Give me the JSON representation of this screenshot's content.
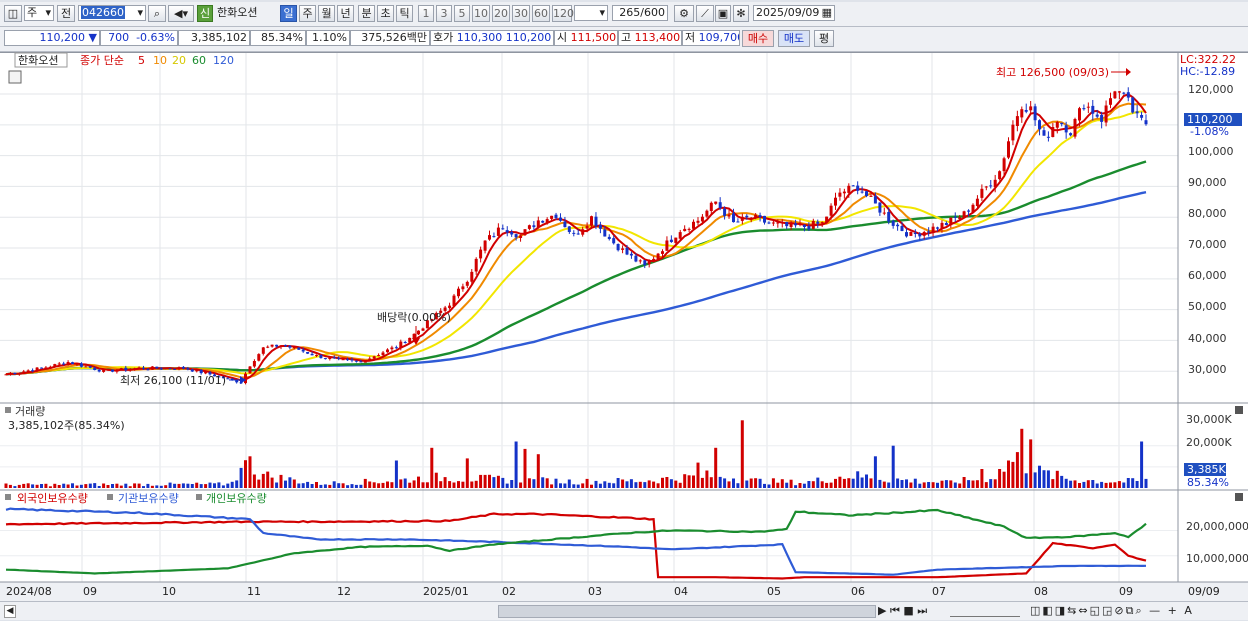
{
  "toolbar1": {
    "type_select": "주",
    "prev_label": "전",
    "code_value": "042660",
    "new_badge": "신",
    "stock_name": "한화오션",
    "periods": [
      "일",
      "주",
      "월",
      "년",
      "분",
      "초",
      "틱"
    ],
    "numbers": [
      "1",
      "3",
      "5",
      "10",
      "20",
      "30",
      "60",
      "120"
    ],
    "count_value": "265",
    "count_total": "/600",
    "date_value": "2025/09/09"
  },
  "toolbar2": {
    "price": "110,200",
    "change_arrow": "▼",
    "change": "700",
    "change_pct": "-0.63%",
    "volume": "3,385,102",
    "vol_ratio": "85.34%",
    "turnover": "1.10%",
    "trade_value": "375,526백만",
    "hoga_label": "호가",
    "hoga_ask": "110,300",
    "hoga_bid": "110,200",
    "open_label": "시",
    "open": "111,500",
    "high_label": "고",
    "high": "113,400",
    "low_label": "저",
    "low": "109,700",
    "buy_label": "매수",
    "sell_label": "매도",
    "eval_label": "평"
  },
  "price_panel": {
    "stock_label": "한화오션",
    "ma_title": "종가 단순",
    "ma_periods": [
      "5",
      "10",
      "20",
      "60",
      "120"
    ],
    "ma_colors": [
      "#d10000",
      "#f08a00",
      "#f2e600",
      "#1a8c2e",
      "#2f5bd6"
    ],
    "lc_label": "LC:322.22",
    "hc_label": "HC:-12.89",
    "y_labels": [
      "120,000",
      "110,000",
      "100,000",
      "90,000",
      "80,000",
      "70,000",
      "60,000",
      "50,000",
      "40,000",
      "30,000"
    ],
    "current_price": "110,200",
    "current_pct": "-1.08%",
    "annotation_high": "최고 126,500 (09/03)",
    "annotation_low": "최저 26,100 (11/01)",
    "annotation_div": "배당락(0.00%)"
  },
  "volume_panel": {
    "title": "거래량",
    "info": "3,385,102주(85.34%)",
    "y_labels": [
      "30,000K",
      "20,000K",
      "10,000K"
    ],
    "current": "3,385K",
    "current_pct": "85.34%"
  },
  "holding_panel": {
    "series_names": [
      "외국인보유수량",
      "기관보유수량",
      "개인보유수량"
    ],
    "series_colors": [
      "#d10000",
      "#2f5bd6",
      "#1a8c2e"
    ],
    "y_labels": [
      "20,000,000",
      "10,000,000"
    ]
  },
  "x_axis": {
    "labels": [
      "2024/08",
      "09",
      "10",
      "11",
      "12",
      "2025/01",
      "02",
      "03",
      "04",
      "05",
      "06",
      "07",
      "08",
      "09"
    ],
    "right_label": "09/09"
  },
  "chart_data": {
    "type": "candlestick",
    "price_range": [
      20000,
      133000
    ],
    "keyframes": [
      [
        0,
        29000
      ],
      [
        8,
        31000
      ],
      [
        14,
        33000
      ],
      [
        22,
        30000
      ],
      [
        30,
        31000
      ],
      [
        40,
        31000
      ],
      [
        46,
        29000
      ],
      [
        51,
        27000
      ],
      [
        53,
        26500
      ],
      [
        55,
        32000
      ],
      [
        58,
        37500
      ],
      [
        62,
        38500
      ],
      [
        66,
        37000
      ],
      [
        70,
        35000
      ],
      [
        75,
        33500
      ],
      [
        80,
        33000
      ],
      [
        83,
        35000
      ],
      [
        88,
        38000
      ],
      [
        92,
        42000
      ],
      [
        96,
        47000
      ],
      [
        100,
        52000
      ],
      [
        104,
        60000
      ],
      [
        108,
        72000
      ],
      [
        112,
        77000
      ],
      [
        116,
        74000
      ],
      [
        120,
        79000
      ],
      [
        124,
        81000
      ],
      [
        128,
        74000
      ],
      [
        132,
        80000
      ],
      [
        136,
        73000
      ],
      [
        140,
        68000
      ],
      [
        144,
        64000
      ],
      [
        148,
        70000
      ],
      [
        152,
        76000
      ],
      [
        156,
        79000
      ],
      [
        160,
        85000
      ],
      [
        164,
        78000
      ],
      [
        168,
        80000
      ],
      [
        172,
        78000
      ],
      [
        176,
        77000
      ],
      [
        180,
        77000
      ],
      [
        184,
        78000
      ],
      [
        188,
        88000
      ],
      [
        192,
        90000
      ],
      [
        196,
        84000
      ],
      [
        200,
        78000
      ],
      [
        204,
        74000
      ],
      [
        208,
        76000
      ],
      [
        212,
        78000
      ],
      [
        216,
        81000
      ],
      [
        220,
        88000
      ],
      [
        224,
        95000
      ],
      [
        227,
        110000
      ],
      [
        229,
        117000
      ],
      [
        231,
        115000
      ],
      [
        234,
        105000
      ],
      [
        237,
        112000
      ],
      [
        240,
        108000
      ],
      [
        243,
        117000
      ],
      [
        247,
        112000
      ],
      [
        250,
        122000
      ],
      [
        253,
        117000
      ],
      [
        255,
        112000
      ],
      [
        257,
        110200
      ]
    ],
    "volume_keyframes": [
      [
        0,
        1500
      ],
      [
        50,
        1800
      ],
      [
        54,
        10000
      ],
      [
        58,
        6000
      ],
      [
        70,
        2000
      ],
      [
        88,
        3500
      ],
      [
        96,
        5000
      ],
      [
        104,
        4500
      ],
      [
        112,
        4000
      ],
      [
        120,
        3500
      ],
      [
        130,
        3000
      ],
      [
        144,
        3500
      ],
      [
        160,
        6000
      ],
      [
        168,
        3500
      ],
      [
        180,
        2500
      ],
      [
        190,
        6000
      ],
      [
        200,
        4000
      ],
      [
        212,
        2500
      ],
      [
        222,
        5000
      ],
      [
        228,
        13000
      ],
      [
        232,
        8000
      ],
      [
        240,
        4000
      ],
      [
        250,
        3000
      ],
      [
        257,
        3385
      ]
    ],
    "volume_spikes": [
      [
        55,
        15000
      ],
      [
        88,
        13000
      ],
      [
        96,
        19000
      ],
      [
        104,
        14000
      ],
      [
        115,
        22000
      ],
      [
        117,
        18500
      ],
      [
        120,
        16000
      ],
      [
        156,
        12000
      ],
      [
        160,
        19000
      ],
      [
        166,
        32000
      ],
      [
        196,
        15000
      ],
      [
        200,
        20000
      ],
      [
        220,
        9000
      ],
      [
        226,
        13000
      ],
      [
        229,
        28000
      ],
      [
        231,
        23000
      ],
      [
        256,
        22000
      ]
    ],
    "holding_foreign": [
      [
        0,
        22500000
      ],
      [
        30,
        23000000
      ],
      [
        55,
        23500000
      ],
      [
        70,
        23500000
      ],
      [
        100,
        23800000
      ],
      [
        110,
        26500000
      ],
      [
        120,
        26500000
      ],
      [
        140,
        25000000
      ],
      [
        146,
        24500000
      ],
      [
        147,
        1500000
      ],
      [
        160,
        1500000
      ],
      [
        175,
        1000000
      ],
      [
        180,
        1500000
      ],
      [
        200,
        1500000
      ],
      [
        210,
        1500000
      ],
      [
        230,
        3000000
      ],
      [
        236,
        15000000
      ],
      [
        245,
        13000000
      ],
      [
        250,
        14500000
      ],
      [
        253,
        10000000
      ],
      [
        257,
        8000000
      ]
    ],
    "holding_inst": [
      [
        0,
        28500000
      ],
      [
        30,
        27000000
      ],
      [
        55,
        24500000
      ],
      [
        58,
        19000000
      ],
      [
        70,
        16500000
      ],
      [
        90,
        16500000
      ],
      [
        110,
        15500000
      ],
      [
        140,
        13500000
      ],
      [
        150,
        12500000
      ],
      [
        175,
        14500000
      ],
      [
        178,
        3500000
      ],
      [
        190,
        3000000
      ],
      [
        200,
        2500000
      ],
      [
        210,
        4500000
      ],
      [
        230,
        5500000
      ],
      [
        240,
        6000000
      ],
      [
        257,
        6000000
      ]
    ],
    "holding_indiv": [
      [
        0,
        4500000
      ],
      [
        20,
        3000000
      ],
      [
        50,
        5000000
      ],
      [
        65,
        11000000
      ],
      [
        80,
        13500000
      ],
      [
        95,
        14000000
      ],
      [
        100,
        12000000
      ],
      [
        110,
        14500000
      ],
      [
        140,
        19000000
      ],
      [
        150,
        20000000
      ],
      [
        170,
        19500000
      ],
      [
        176,
        20500000
      ],
      [
        178,
        27500000
      ],
      [
        190,
        26000000
      ],
      [
        200,
        27000000
      ],
      [
        210,
        28000000
      ],
      [
        225,
        21500000
      ],
      [
        230,
        17000000
      ],
      [
        240,
        17500000
      ],
      [
        250,
        19000000
      ],
      [
        253,
        17500000
      ],
      [
        257,
        22500000
      ]
    ],
    "holding_range": [
      0,
      30500000
    ],
    "volume_range": [
      0,
      35000
    ],
    "n_bars": 258
  }
}
